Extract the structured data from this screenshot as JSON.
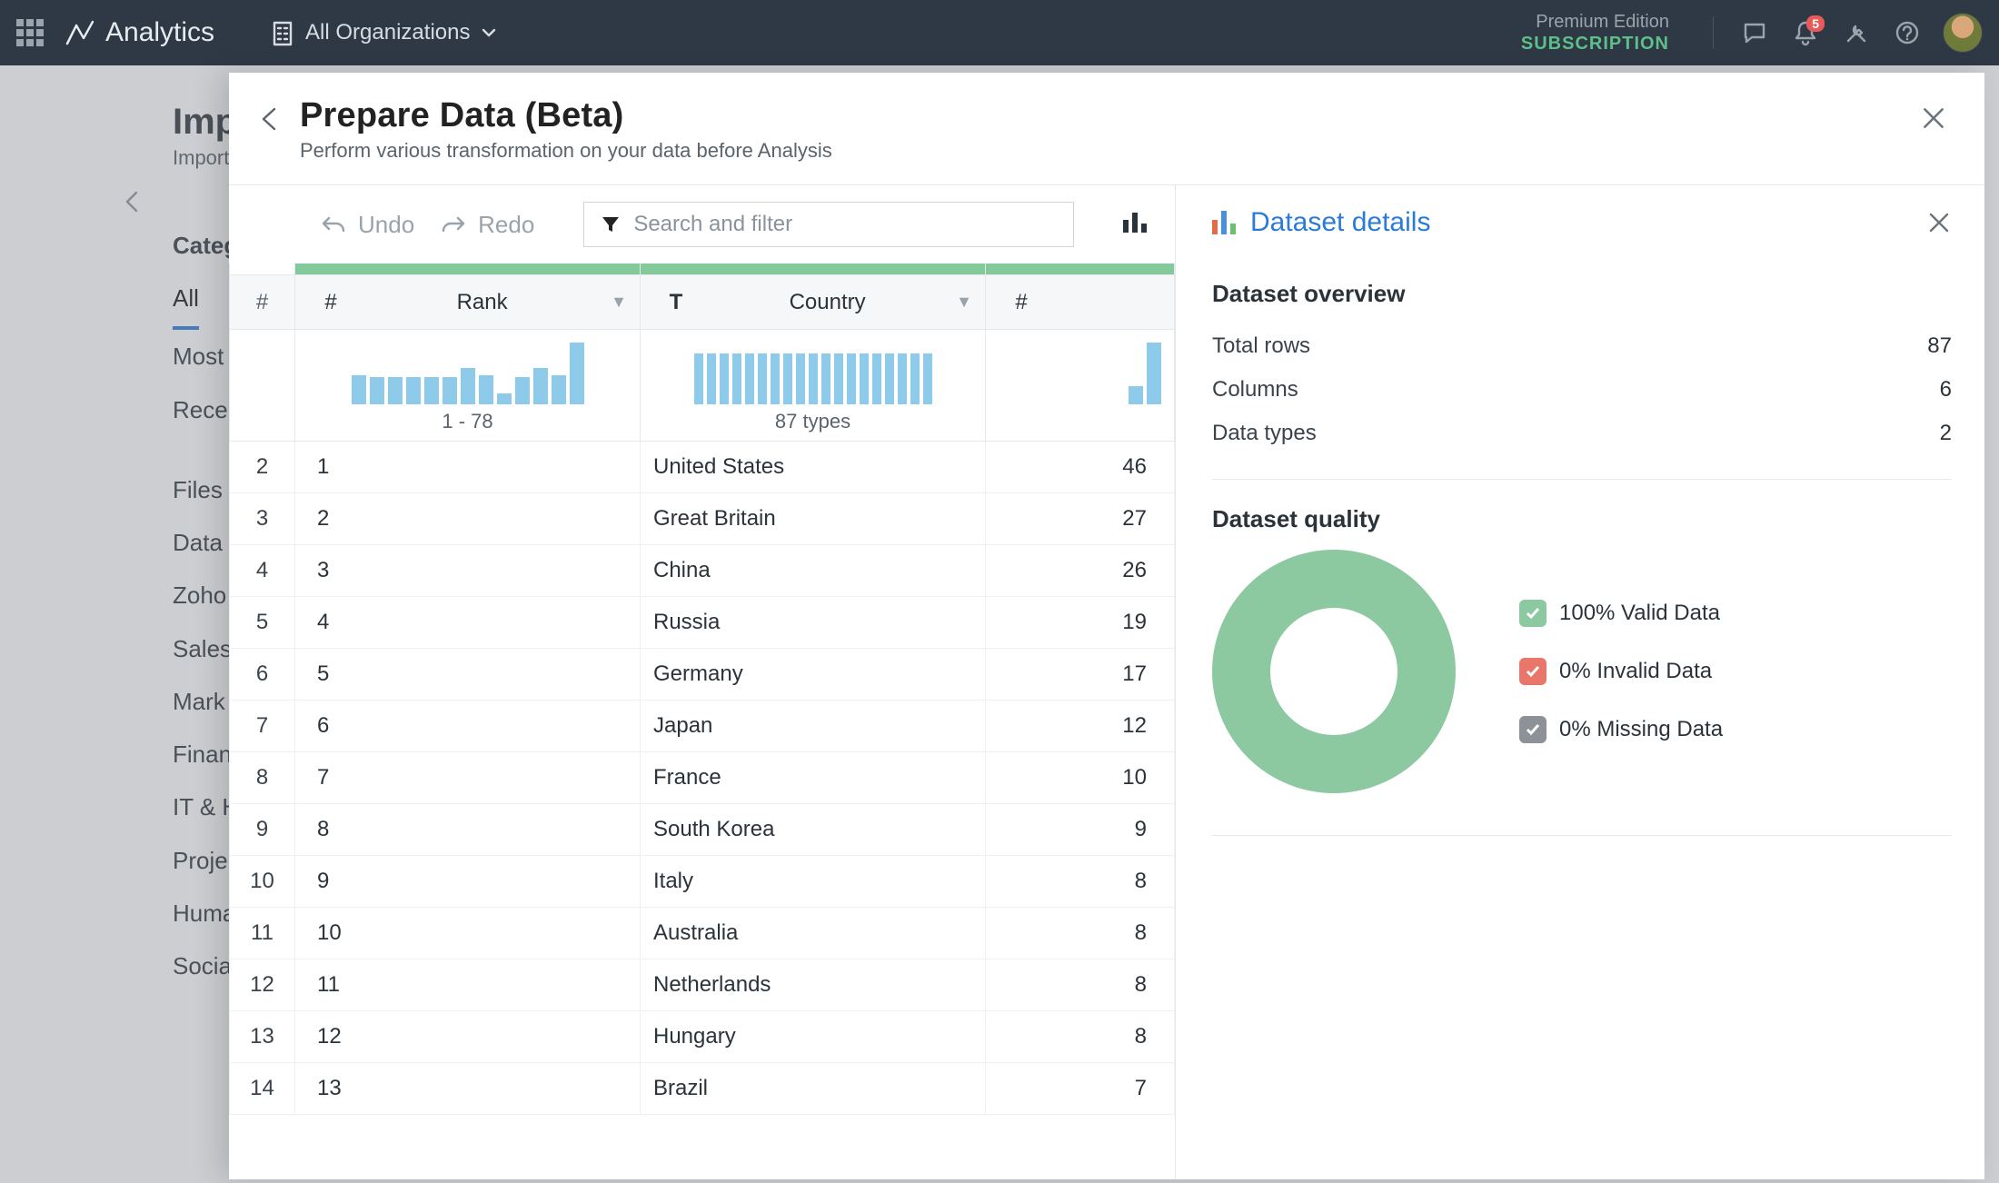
{
  "topbar": {
    "product": "Analytics",
    "org_label": "All Organizations",
    "edition_line1": "Premium Edition",
    "edition_line2": "SUBSCRIPTION",
    "notification_count": "5"
  },
  "background": {
    "title": "Import",
    "subtitle": "Import",
    "cat_header": "Categories",
    "cats": [
      "All",
      "Most Popular",
      "Recent",
      "Files",
      "Databases",
      "Zoho",
      "Sales",
      "Marketing",
      "Finance",
      "IT & Help Desk",
      "Project",
      "Human Resources",
      "Social"
    ],
    "cats_display": [
      "All",
      "Most",
      "Rece",
      "Files",
      "Data",
      "Zoho",
      "Sales",
      "Mark",
      "Finan",
      "IT & H",
      "Proje",
      "Huma",
      "Socia"
    ]
  },
  "panel": {
    "title": "Prepare Data (Beta)",
    "subtitle": "Perform various transformation on your data before Analysis",
    "undo": "Undo",
    "redo": "Redo",
    "search_placeholder": "Search and filter"
  },
  "columns": {
    "c1_type": "#",
    "c2_type": "#",
    "c2_label": "Rank",
    "c3_type": "T",
    "c3_label": "Country",
    "c4_type": "#",
    "spark_rank_caption": "1 - 78",
    "spark_country_caption": "87 types"
  },
  "rows": [
    {
      "rn": "2",
      "rank": "1",
      "country": "United States",
      "val": "46"
    },
    {
      "rn": "3",
      "rank": "2",
      "country": "Great Britain",
      "val": "27"
    },
    {
      "rn": "4",
      "rank": "3",
      "country": "China",
      "val": "26"
    },
    {
      "rn": "5",
      "rank": "4",
      "country": "Russia",
      "val": "19"
    },
    {
      "rn": "6",
      "rank": "5",
      "country": "Germany",
      "val": "17"
    },
    {
      "rn": "7",
      "rank": "6",
      "country": "Japan",
      "val": "12"
    },
    {
      "rn": "8",
      "rank": "7",
      "country": "France",
      "val": "10"
    },
    {
      "rn": "9",
      "rank": "8",
      "country": "South Korea",
      "val": "9"
    },
    {
      "rn": "10",
      "rank": "9",
      "country": "Italy",
      "val": "8"
    },
    {
      "rn": "11",
      "rank": "10",
      "country": "Australia",
      "val": "8"
    },
    {
      "rn": "12",
      "rank": "11",
      "country": "Netherlands",
      "val": "8"
    },
    {
      "rn": "13",
      "rank": "12",
      "country": "Hungary",
      "val": "8"
    },
    {
      "rn": "14",
      "rank": "13",
      "country": "Brazil",
      "val": "7"
    }
  ],
  "details": {
    "title": "Dataset details",
    "overview_title": "Dataset overview",
    "total_rows_label": "Total rows",
    "total_rows_value": "87",
    "columns_label": "Columns",
    "columns_value": "6",
    "datatypes_label": "Data types",
    "datatypes_value": "2",
    "quality_title": "Dataset quality",
    "legend_valid": "100% Valid Data",
    "legend_invalid": "0% Invalid Data",
    "legend_missing": "0% Missing Data"
  },
  "chart_data": {
    "type": "pie",
    "title": "Dataset quality",
    "series": [
      {
        "name": "Valid Data",
        "value": 100,
        "color": "#8cc8a0"
      },
      {
        "name": "Invalid Data",
        "value": 0,
        "color": "#e9766a"
      },
      {
        "name": "Missing Data",
        "value": 0,
        "color": "#8d9299"
      }
    ]
  }
}
